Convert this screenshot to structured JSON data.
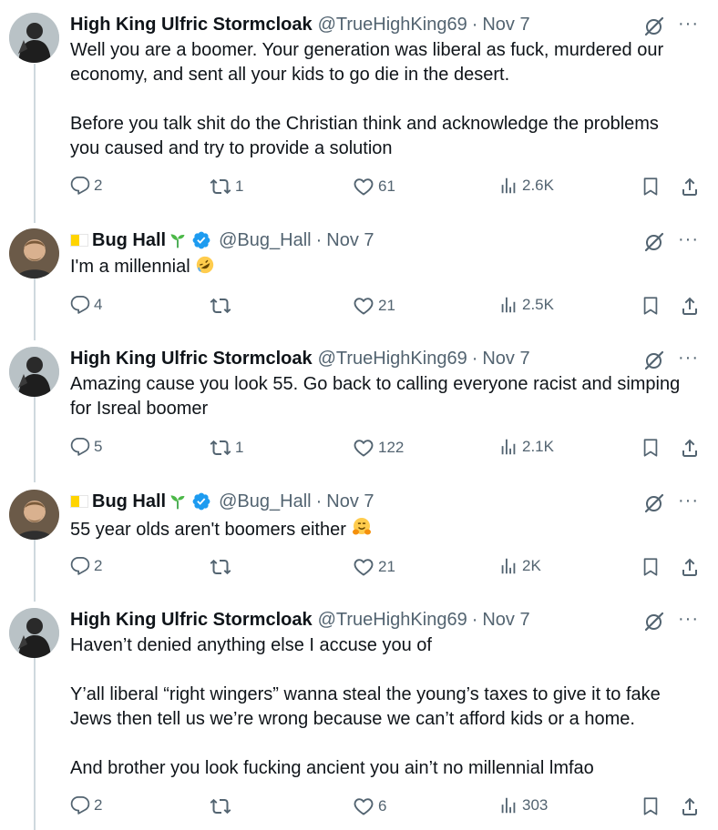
{
  "tweets": [
    {
      "name": "High King Ulfric Stormcloak",
      "handle": "@TrueHighKing69",
      "dot": "·",
      "date": "Nov 7",
      "text": [
        "Well you are a boomer. Your generation was liberal as fuck, murdered our",
        "economy, and sent all your kids to go die in the desert.",
        "",
        "Before you talk shit do the Christian think and acknowledge the problems",
        "you caused and try to provide a solution"
      ],
      "replies": "2",
      "reposts": "1",
      "likes": "61",
      "views": "2.6K"
    },
    {
      "name": "Bug Hall",
      "handle": "@Bug_Hall",
      "dot": "·",
      "date": "Nov 7",
      "text": [
        "I'm a millennial"
      ],
      "emoji": "rolling-on-floor-laughing",
      "replies": "4",
      "reposts": "",
      "likes": "21",
      "views": "2.5K"
    },
    {
      "name": "High King Ulfric Stormcloak",
      "handle": "@TrueHighKing69",
      "dot": "·",
      "date": "Nov 7",
      "text": [
        "Amazing cause you look 55. Go back to calling everyone racist and simping",
        "for Isreal boomer"
      ],
      "replies": "5",
      "reposts": "1",
      "likes": "122",
      "views": "2.1K"
    },
    {
      "name": "Bug Hall",
      "handle": "@Bug_Hall",
      "dot": "·",
      "date": "Nov 7",
      "text": [
        "55 year olds aren't boomers either"
      ],
      "emoji": "hugging-face",
      "replies": "2",
      "reposts": "",
      "likes": "21",
      "views": "2K"
    },
    {
      "name": "High King Ulfric Stormcloak",
      "handle": "@TrueHighKing69",
      "dot": "·",
      "date": "Nov 7",
      "text": [
        "Haven’t denied anything else I accuse you of",
        "",
        "Y’all liberal “right wingers” wanna steal the young’s taxes to give it to fake",
        "Jews then tell us we’re wrong because we can’t afford kids or a home.",
        "",
        "And brother you look fucking ancient you ain’t no millennial lmfao"
      ],
      "replies": "2",
      "reposts": "",
      "likes": "6",
      "views": "303"
    }
  ],
  "colors": {
    "text": "#0f1419",
    "secondary": "#536471",
    "thread_line": "#cfd9de",
    "verified": "#1d9bf0"
  },
  "icons": [
    "reply-icon",
    "repost-icon",
    "like-icon",
    "views-icon",
    "bookmark-icon",
    "share-icon",
    "grok-icon",
    "more-icon",
    "verified-badge-icon",
    "sprout-icon",
    "flag-icon"
  ]
}
